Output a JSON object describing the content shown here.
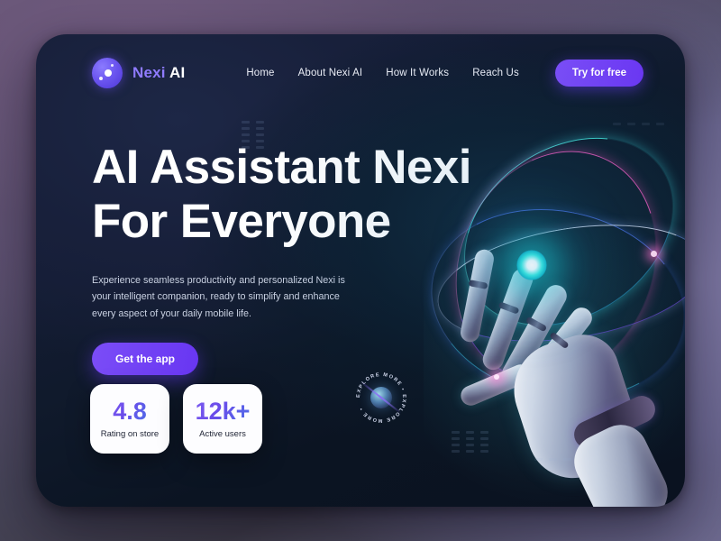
{
  "brand": {
    "name_accent": "Nexi",
    "name_plain": "AI",
    "logo_icon": "nexi-orb-logo"
  },
  "nav": {
    "links": [
      {
        "label": "Home"
      },
      {
        "label": "About Nexi AI"
      },
      {
        "label": "How It Works"
      },
      {
        "label": "Reach Us"
      }
    ],
    "cta_label": "Try for free"
  },
  "hero": {
    "title_line1": "AI Assistant Nexi",
    "title_line2": "For Everyone",
    "subtitle": "Experience seamless productivity and personalized  Nexi is your intelligent companion, ready to simplify and enhance every aspect of your daily mobile life.",
    "cta_label": "Get the app"
  },
  "stats": [
    {
      "value": "4.8",
      "label": "Rating on store"
    },
    {
      "value": "12k+",
      "label": "Active users"
    }
  ],
  "explore_badge": {
    "text": "EXPLORE MORE • EXPLORE MORE • "
  },
  "artwork": {
    "hand_icon": "robotic-hand",
    "atom_icon": "glowing-atom-orbits"
  },
  "colors": {
    "accent_purple": "#6C3CF5",
    "brand_purple": "#8F7BFF",
    "card_dark": "#101A2C",
    "page_purple": "#6B5A78",
    "atom_cyan": "#2BD9D9",
    "atom_pink": "#F05ABE"
  }
}
